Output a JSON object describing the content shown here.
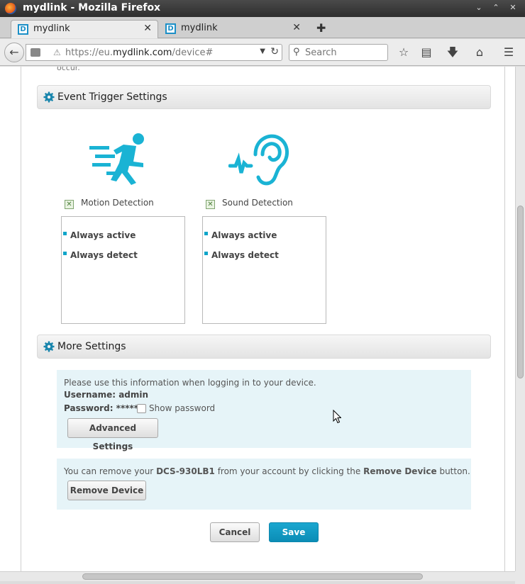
{
  "window": {
    "title": "mydlink - Mozilla Firefox"
  },
  "tabs": [
    {
      "label": "mydlink",
      "active": true
    },
    {
      "label": "mydlink",
      "active": false
    }
  ],
  "nav": {
    "url_prefix": "https://eu.",
    "url_domain": "mydlink.com",
    "url_suffix": "/device#",
    "search_placeholder": "Search"
  },
  "page": {
    "top_fragment": "occur.",
    "event_section": {
      "title": "Event Trigger Settings",
      "events": [
        {
          "label": "Motion Detection",
          "items": [
            "Always active",
            "Always detect"
          ],
          "icon": "running-person-icon"
        },
        {
          "label": "Sound Detection",
          "items": [
            "Always active",
            "Always detect"
          ],
          "icon": "ear-sound-icon"
        }
      ]
    },
    "more_section": {
      "title": "More Settings",
      "login_info": "Please use this information when logging in to your device.",
      "username_label": "Username: admin",
      "password_label": "Password: ******",
      "show_password_label": "Show password",
      "advanced_button": "Advanced Settings",
      "remove_text_1": "You can remove your ",
      "remove_device_name": "DCS-930LB1",
      "remove_text_2": " from your account by clicking the ",
      "remove_text_bold": "Remove Device",
      "remove_text_3": " button.",
      "remove_button": "Remove Device"
    },
    "actions": {
      "cancel": "Cancel",
      "save": "Save"
    }
  },
  "colors": {
    "accent": "#1aa7d0",
    "icon_blue": "#1ab3d4"
  }
}
